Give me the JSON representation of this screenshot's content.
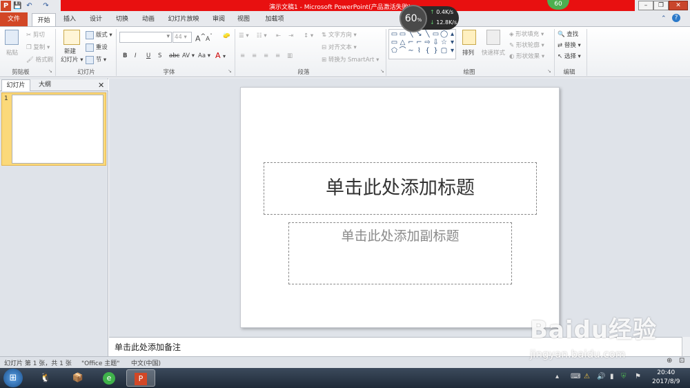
{
  "window": {
    "title": "演示文稿1 - Microsoft PowerPoint(产品激活失败)",
    "app_icon": "P",
    "controls": [
      "minimize-icon",
      "restore-icon",
      "close-icon"
    ]
  },
  "tabs": [
    "文件",
    "开始",
    "插入",
    "设计",
    "切换",
    "动画",
    "幻灯片放映",
    "审阅",
    "视图",
    "加载项"
  ],
  "active_tab": "开始",
  "ribbon": {
    "clipboard": {
      "paste": "粘贴",
      "cut": "剪切",
      "copy": "复制",
      "format_painter": "格式刷",
      "label": "剪贴板"
    },
    "slides": {
      "new_slide": "新建",
      "new_slide2": "幻灯片",
      "layout": "版式",
      "reset": "重设",
      "section": "节",
      "label": "幻灯片"
    },
    "font": {
      "font_name": "",
      "font_size": "44",
      "bold": "B",
      "italic": "I",
      "underline": "U",
      "shadow": "S",
      "strike": "abc",
      "spacing": "AV",
      "case": "Aa",
      "grow": "A",
      "shrink": "A",
      "label": "字体"
    },
    "paragraph": {
      "text_direction": "文字方向",
      "align_text": "对齐文本",
      "smartart": "转换为 SmartArt",
      "label": "段落"
    },
    "drawing": {
      "arrange": "排列",
      "quick_styles": "快速样式",
      "shape_fill": "形状填充",
      "shape_outline": "形状轮廓",
      "shape_effects": "形状效果",
      "label": "绘图"
    },
    "editing": {
      "find": "查找",
      "replace": "替换",
      "select": "选择",
      "label": "编辑"
    }
  },
  "left_pane": {
    "tab_slides": "幻灯片",
    "tab_outline": "大纲",
    "slide_number": "1"
  },
  "slide": {
    "title_placeholder": "单击此处添加标题",
    "subtitle_placeholder": "单击此处添加副标题"
  },
  "notes": {
    "placeholder": "单击此处添加备注"
  },
  "status": {
    "slide_info": "幻灯片 第 1 张，共 1 张",
    "theme": "\"Office 主题\"",
    "language": "中文(中国)"
  },
  "speed_widget": {
    "percent": "60",
    "unit": "%",
    "up": "0.4K/s",
    "down": "12.8K/s"
  },
  "green_badge": "60",
  "taskbar": {
    "time": "20:40",
    "date": "2017/8/9"
  },
  "watermark": {
    "brand": "Baidu经验",
    "url": "jingyan.baidu.com"
  },
  "colors": {
    "file_tab": "#d24726",
    "title_bar": "#e81010",
    "taskbar": "#2a3647"
  }
}
